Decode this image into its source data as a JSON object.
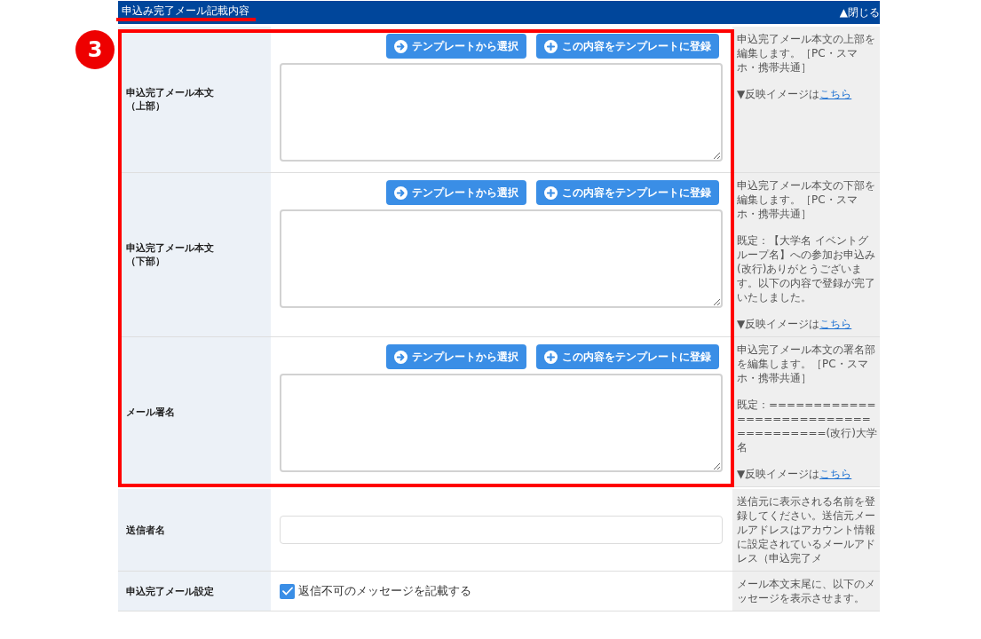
{
  "section": {
    "title": "申込み完了メール記載内容",
    "toggle": "▲閉じる"
  },
  "highlight": {
    "number": "3",
    "rows": [
      {
        "kind": "textarea",
        "label": [
          "申込完了メール本文",
          "（上部）"
        ],
        "buttons": [
          {
            "kind": "select",
            "label": "テンプレートから選択"
          },
          {
            "kind": "register",
            "label": "この内容をテンプレートに登録"
          }
        ],
        "note": {
          "paragraphs": [
            "申込完了メール本文の上部を編集します。［PC・スマホ・携帯共通］"
          ],
          "preview": {
            "text": "▼反映イメージは",
            "link": "こちら"
          }
        }
      },
      {
        "kind": "textarea",
        "label": [
          "申込完了メール本文",
          "（下部）"
        ],
        "buttons": [
          {
            "kind": "select",
            "label": "テンプレートから選択"
          },
          {
            "kind": "register",
            "label": "この内容をテンプレートに登録"
          }
        ],
        "note": {
          "paragraphs": [
            "申込完了メール本文の下部を編集します。［PC・スマホ・携帯共通］",
            "既定：【大学名 イベントグループ名】への参加お申込み(改行)ありがとうございます。以下の内容で登録が完了いたしました。"
          ],
          "preview": {
            "text": "▼反映イメージは",
            "link": "こちら"
          }
        }
      },
      {
        "kind": "textarea",
        "label": [
          "メール署名"
        ],
        "buttons": [
          {
            "kind": "select",
            "label": "テンプレートから選択"
          },
          {
            "kind": "register",
            "label": "この内容をテンプレートに登録"
          }
        ],
        "note": {
          "paragraphs": [
            "申込完了メール本文の署名部を編集します。［PC・スマホ・携帯共通］",
            "既定：=====================================(改行)大学名"
          ],
          "preview": {
            "text": "▼反映イメージは",
            "link": "こちら"
          }
        }
      }
    ]
  },
  "rows": [
    {
      "kind": "input",
      "label": [
        "送信者名"
      ],
      "note": {
        "paragraphs": [
          "送信元に表示される名前を登録してください。送信元メールアドレスはアカウント情報に設定されているメールアドレス（申込完了メ"
        ]
      }
    },
    {
      "kind": "checkbox",
      "label": [
        "申込完了メール設定"
      ],
      "checkbox": {
        "label": "返信不可のメッセージを記載する",
        "checked": true
      },
      "note": {
        "paragraphs": [
          "メール本文末尾に、以下のメッセージを表示させます。"
        ]
      }
    }
  ]
}
